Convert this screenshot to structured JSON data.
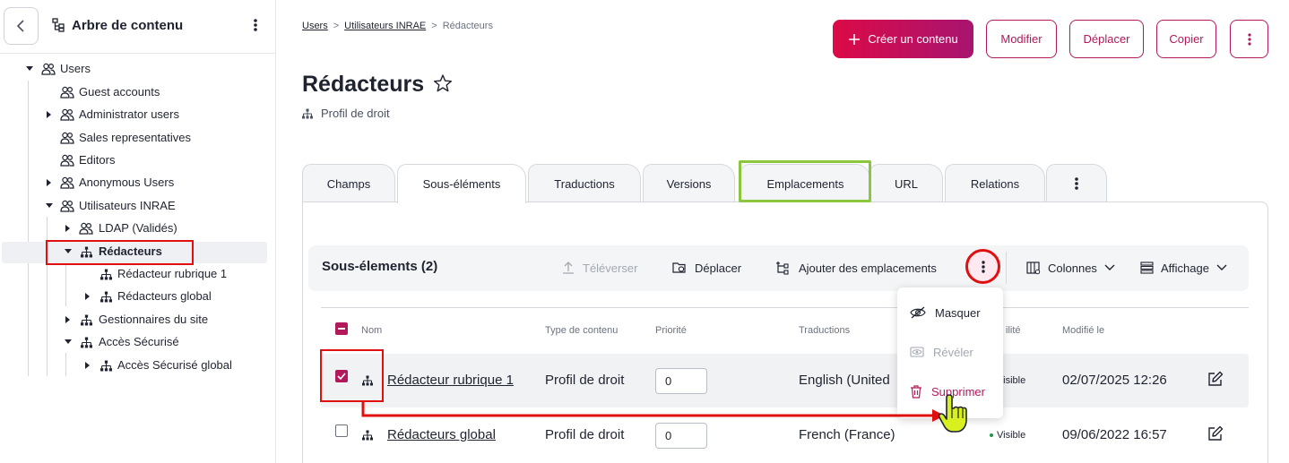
{
  "sidebar": {
    "title": "Arbre de contenu",
    "tree": [
      {
        "label": "Users"
      },
      {
        "label": "Guest accounts"
      },
      {
        "label": "Administrator users"
      },
      {
        "label": "Sales representatives"
      },
      {
        "label": "Editors"
      },
      {
        "label": "Anonymous Users"
      },
      {
        "label": "Utilisateurs INRAE"
      },
      {
        "label": "LDAP (Validés)"
      },
      {
        "label": "Rédacteurs"
      },
      {
        "label": "Rédacteur rubrique 1"
      },
      {
        "label": "Rédacteurs global"
      },
      {
        "label": "Gestionnaires du site"
      },
      {
        "label": "Accès Sécurisé"
      },
      {
        "label": "Accès Sécurisé global"
      }
    ]
  },
  "breadcrumb": {
    "items": [
      "Users",
      "Utilisateurs INRAE"
    ],
    "current": "Rédacteurs",
    "separator": ">"
  },
  "header": {
    "title": "Rédacteurs",
    "subtitle": "Profil de droit",
    "actions": {
      "create": "Créer un contenu",
      "edit": "Modifier",
      "move": "Déplacer",
      "copy": "Copier"
    }
  },
  "tabs": [
    "Champs",
    "Sous-éléments",
    "Traductions",
    "Versions",
    "Emplacements",
    "URL",
    "Relations"
  ],
  "subitems": {
    "title": "Sous-élements (2)",
    "toolbar": {
      "upload": "Téléverser",
      "move": "Déplacer",
      "add_locations": "Ajouter des emplacements",
      "columns": "Colonnes",
      "display": "Affichage"
    },
    "columns": {
      "name": "Nom",
      "type": "Type de contenu",
      "priority": "Priorité",
      "translations": "Traductions",
      "visibility_tail": "ilité",
      "modified": "Modifié le"
    },
    "rows": [
      {
        "name": "Rédacteur rubrique 1",
        "type": "Profil de droit",
        "priority": "0",
        "translation": "English (United",
        "visibility": "Visible",
        "modified": "02/07/2025 12:26",
        "checked": true
      },
      {
        "name": "Rédacteurs global",
        "type": "Profil de droit",
        "priority": "0",
        "translation": "French (France)",
        "visibility": "Visible",
        "modified": "09/06/2022 16:57",
        "checked": false
      }
    ]
  },
  "menu": {
    "hide": "Masquer",
    "reveal": "Révéler",
    "delete": "Supprimer"
  },
  "colors": {
    "accent": "#b2195b",
    "accent_gradient_start": "#dc0a47",
    "annotation_red": "#e01010",
    "annotation_green": "#8cc63f",
    "visible_dot": "#1d9a4d"
  }
}
